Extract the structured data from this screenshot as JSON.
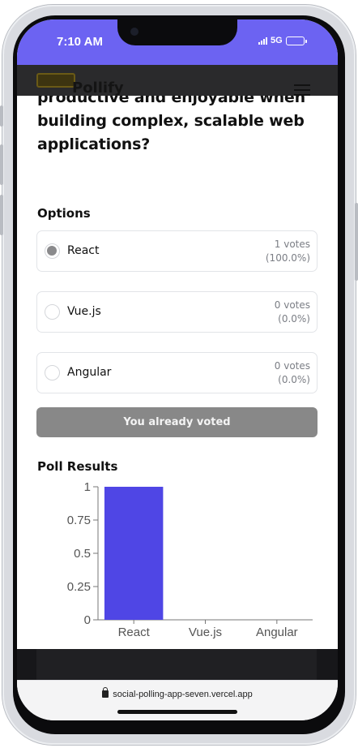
{
  "status_bar": {
    "time": "7:10 AM",
    "network": "5G",
    "color": "#6c63f2"
  },
  "background_app": {
    "brand": "Pollify"
  },
  "poll": {
    "question": "productive and enjoyable when building complex, scalable web applications?",
    "options_label": "Options",
    "options": [
      {
        "label": "React",
        "votes": "1 votes",
        "percent": "(100.0%)",
        "selected": true
      },
      {
        "label": "Vue.js",
        "votes": "0 votes",
        "percent": "(0.0%)",
        "selected": false
      },
      {
        "label": "Angular",
        "votes": "0 votes",
        "percent": "(0.0%)",
        "selected": false
      }
    ],
    "voted_button": "You already voted",
    "results_label": "Poll Results"
  },
  "chart_data": {
    "type": "bar",
    "categories": [
      "React",
      "Vue.js",
      "Angular"
    ],
    "values": [
      1,
      0,
      0
    ],
    "yticks": [
      "0",
      "0.25",
      "0.5",
      "0.75",
      "1"
    ],
    "ylim": [
      0,
      1
    ],
    "bar_color": "#4f46e5",
    "grid": false
  },
  "browser": {
    "url": "social-polling-app-seven.vercel.app"
  }
}
